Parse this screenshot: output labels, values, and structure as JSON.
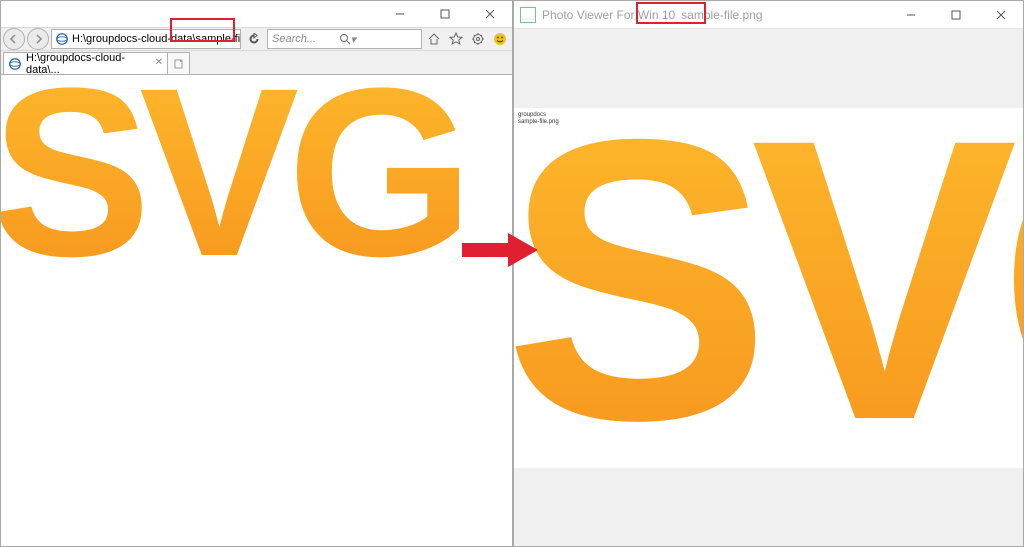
{
  "ie": {
    "address": "H:\\groupdocs-cloud-data\\sample-file.svg",
    "searchPlaceholder": "Search...",
    "tabLabel": "H:\\groupdocs-cloud-data\\...",
    "contentText": "SVG"
  },
  "photoViewer": {
    "appName": "Photo Viewer For Win 10",
    "fileName": "sample-file.png",
    "contentText": "SVG",
    "metaLine1": "groupdocs",
    "metaLine2": "sample-file.png"
  },
  "colors": {
    "highlight": "#e02030",
    "svgGradTop": "#fdbb2d",
    "svgGradBottom": "#f7941d"
  }
}
